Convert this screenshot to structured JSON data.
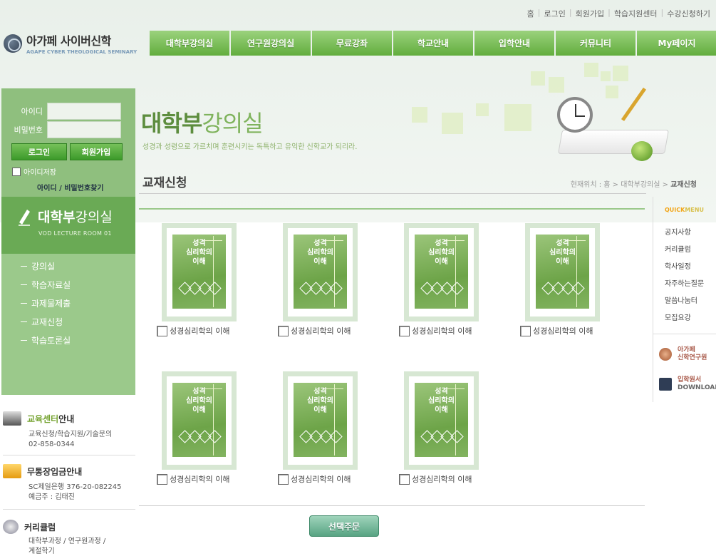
{
  "util_nav": [
    "홈",
    "로그인",
    "회원가입",
    "학습지원센터",
    "수강신청하기"
  ],
  "logo": {
    "name": "아가페 사이버신학",
    "subtitle": "AGAPE CYBER THEOLOGICAL SEMINARY"
  },
  "gnb": [
    "대학부강의실",
    "연구원강의실",
    "무료강좌",
    "학교안내",
    "입학안내",
    "커뮤니티",
    "My페이지"
  ],
  "login": {
    "id_label": "아이디",
    "pw_label": "비밀번호",
    "login_btn": "로그인",
    "join_btn": "회원가입",
    "save_id": "아이디저장",
    "find": "아이디 / 비밀번호찾기"
  },
  "side": {
    "title_bold": "대학부",
    "title_rest": "강의실",
    "title_en": "VOD LECTURE ROOM 01",
    "menu": [
      "강의실",
      "학습자료실",
      "과제물제출",
      "교재신청",
      "학습토론실"
    ]
  },
  "info": [
    {
      "title_hl": "교육센터",
      "title_rest": "안내",
      "desc": [
        "교육신청/학습지원/기술문의",
        "02-858-0344"
      ]
    },
    {
      "title_hl": "",
      "title_rest": "무통장입금안내",
      "desc": [
        "SC제일은행 376-20-082245",
        "예금주 : 김태진"
      ]
    },
    {
      "title_hl": "",
      "title_rest": "커리큘럼",
      "desc": [
        "대학부과정 / 연구원과정 /",
        "계절학기"
      ]
    }
  ],
  "header": {
    "title_bold": "대학부",
    "title_rest": "강의실",
    "subtitle": "성경과 성령으로 가르치며 훈련시키는 독특하고 유익한 신학교가 되리라."
  },
  "page_heading": "교재신청",
  "breadcrumb": {
    "prefix": "현재위치 : 홈 > 대학부강의실 > ",
    "current": "교재신청"
  },
  "book_cover_title": [
    "성격",
    "심리학의",
    "이해"
  ],
  "books": [
    "성경심리학의 이해",
    "성경심리학의 이해",
    "성경심리학의 이해",
    "성경심리학의 이해",
    "성경심리학의 이해",
    "성경심리학의 이해",
    "성경심리학의 이해"
  ],
  "order_btn": "선택주문",
  "quick": {
    "title_a": "QUICK",
    "title_b": "MENU",
    "items": [
      "공지사항",
      "커리큘럼",
      "학사일정",
      "자주하는질문",
      "말씀나눔터",
      "모집요강"
    ],
    "banners": [
      {
        "line1": "아가페",
        "line2": "신학연구원"
      },
      {
        "line1": "입학원서",
        "line2": "DOWNLOAD"
      }
    ]
  },
  "colors": {
    "green_nav": "#62ad3d",
    "side_green": "#9bc98b",
    "header_green": "#7fb35c"
  }
}
